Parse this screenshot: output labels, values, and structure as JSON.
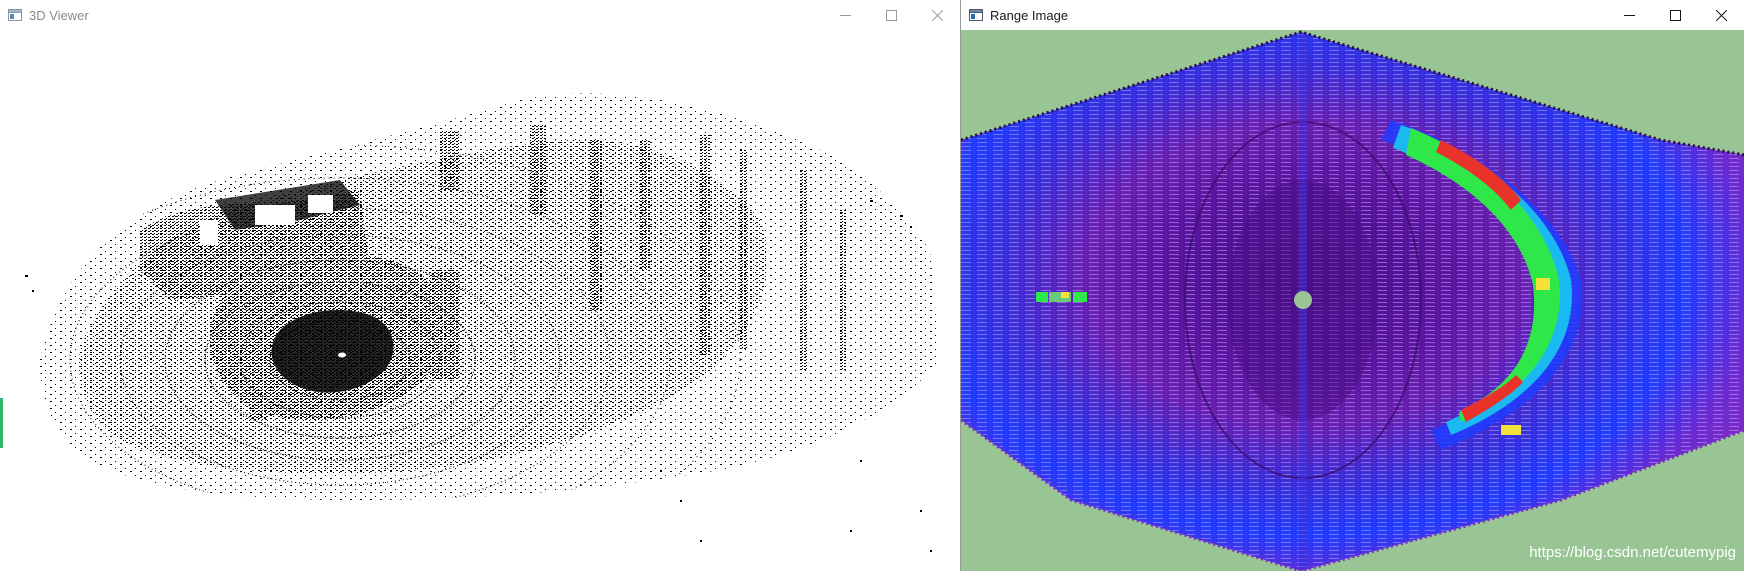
{
  "windows": {
    "viewer": {
      "title": "3D Viewer"
    },
    "range": {
      "title": "Range Image",
      "watermark": "https://blog.csdn.net/cutemypig"
    }
  },
  "controls": {
    "minimize_icon": "minimize-icon",
    "maximize_icon": "maximize-icon",
    "close_icon": "close-icon"
  },
  "colors": {
    "point_cloud": "#000000",
    "range_background": "#98c593",
    "range_center": "#4a0e86",
    "range_inner": "#6a1fb0",
    "range_ring_blue": "#1f3cff",
    "range_ring_cyan": "#19c8f0",
    "range_ring_green": "#2ee84a",
    "range_hot_red": "#e8322a",
    "range_hot_yellow": "#f2e23a"
  }
}
